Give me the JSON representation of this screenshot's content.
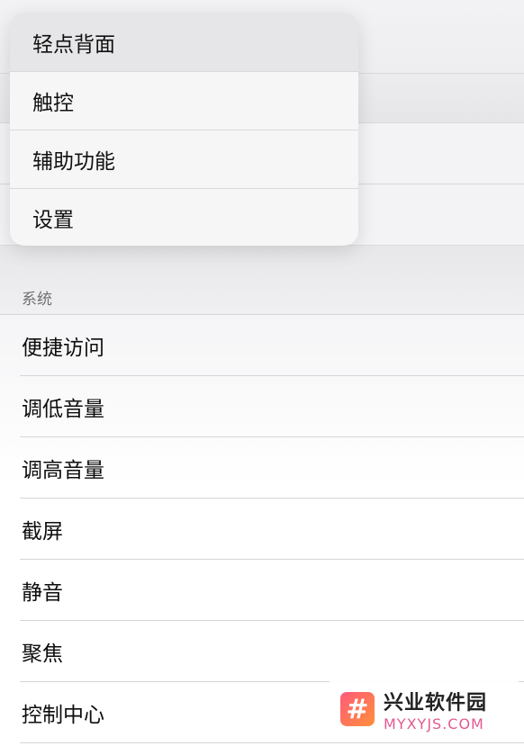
{
  "popup_menu": {
    "items": [
      {
        "label": "轻点背面",
        "active": true
      },
      {
        "label": "触控",
        "active": false
      },
      {
        "label": "辅助功能",
        "active": false
      },
      {
        "label": "设置",
        "active": false
      }
    ]
  },
  "system_section": {
    "header": "系统",
    "items": [
      {
        "label": "便捷访问"
      },
      {
        "label": "调低音量"
      },
      {
        "label": "调高音量"
      },
      {
        "label": "截屏"
      },
      {
        "label": "静音"
      },
      {
        "label": "聚焦"
      },
      {
        "label": "控制中心"
      }
    ]
  },
  "watermark": {
    "badge": "#",
    "name": "兴业软件园",
    "domain": "MYXYJS.COM"
  }
}
